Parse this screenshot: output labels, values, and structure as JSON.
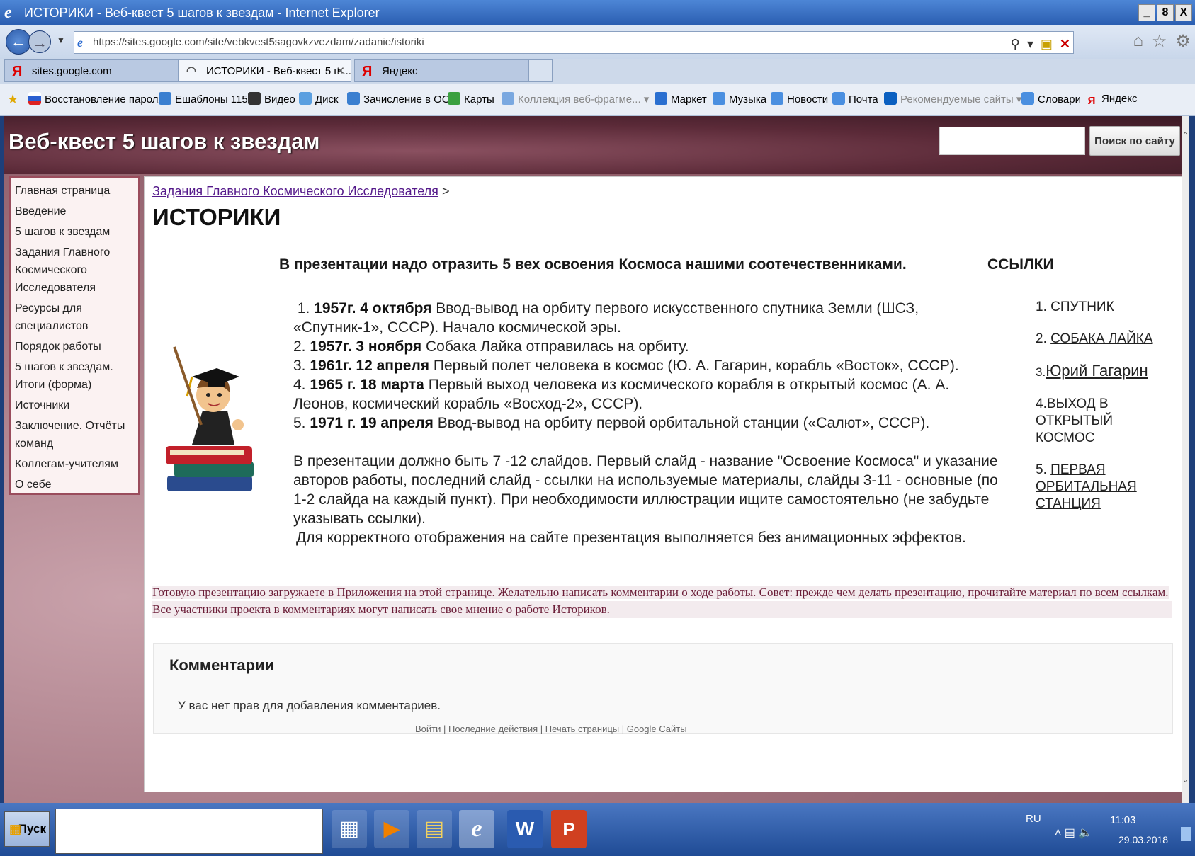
{
  "window": {
    "title": "ИСТОРИКИ - Веб-квест 5 шагов к звездам - Internet Explorer",
    "controls": [
      "_",
      "8",
      "X"
    ]
  },
  "browser": {
    "address": "https://sites.google.com/site/vebkvest5sagovkzvezdam/zadanie/istoriki",
    "tabs": [
      {
        "label": "sites.google.com",
        "icon": "yandex-icon"
      },
      {
        "label": "ИСТОРИКИ - Веб-квест 5 ш...",
        "icon": "loading-icon"
      },
      {
        "label": "Яндекс",
        "icon": "yandex-icon"
      }
    ],
    "favorites": [
      "Восстановление пароля",
      "Ешаблоны 115",
      "Видео",
      "Диск",
      "Зачисление в ОО",
      "Карты",
      "Коллекция веб-фрагме...",
      "Маркет",
      "Музыка",
      "Новости",
      "Почта",
      "Рекомендуемые сайты",
      "Словари",
      "Яндекс"
    ]
  },
  "site": {
    "title": "Веб-квест 5 шагов к звездам",
    "search_button": "Поиск по сайту",
    "nav": [
      "Главная страница",
      "Введение",
      "5 шагов к звездам",
      "Задания Главного Космического Исследователя",
      "Ресурсы для специалистов",
      "Порядок работы",
      "5 шагов к звездам. Итоги (форма)",
      "Источники",
      "Заключение. Отчёты команд",
      "Коллегам-учителям",
      "О себе"
    ]
  },
  "page": {
    "breadcrumb_link": "Задания Главного Космического Исследователя",
    "breadcrumb_sep": ">",
    "title": "ИСТОРИКИ",
    "intro": "В презентации надо отразить 5 вех освоения Космоса нашими соотечественниками.",
    "links_heading": "ССЫЛКИ",
    "milestones": [
      {
        "num": "1.",
        "date": "1957г. 4 октября",
        "text": " Ввод-вывод на орбиту первого искусственного спутника Земли (ШСЗ, «Спутник-1», СССР). Начало космической эры."
      },
      {
        "num": "2.",
        "date": "1957г. 3 ноября",
        "text": "  Собака Лайка отправилась на орбиту."
      },
      {
        "num": "3.",
        "date": "1961г.  12 апреля",
        "text": " Первый полет человека в космос (Ю. А. Гагарин, корабль «Восток», СССР)."
      },
      {
        "num": "4.",
        "date": " 1965 г. 18 марта",
        "text": " Первый выход человека из космического корабля в открытый космос (А. А. Леонов, космический корабль «Восход-2», СССР)."
      },
      {
        "num": "5.",
        "date": " 1971 г. 19 апреля",
        "text": " Ввод-вывод на орбиту первой орбитальной станции («Салют», СССР)."
      }
    ],
    "instructions": "В презентации должно быть 7 -12 слайдов. Первый слайд - название \"Освоение Космоса\" и  указание авторов работы, последний слайд - ссылки на используемые материалы, слайды 3-11 - основные (по 1-2 слайда на каждый пункт).   При необходимости иллюстрации ищите самостоятельно (не забудьте указывать ссылки).",
    "instructions2": "Для корректного отображения на сайте презентация выполняется без анимационных эффектов.",
    "links": [
      {
        "num": "1.",
        "label": " СПУТНИК"
      },
      {
        "num": "2. ",
        "label": "СОБАКА ЛАЙКА"
      },
      {
        "num": "3.",
        "label": "Юрий Гагарин"
      },
      {
        "num": "4.",
        "label": "ВЫХОД В ОТКРЫТЫЙ КОСМОС"
      },
      {
        "num": "5. ",
        "label": "ПЕРВАЯ ОРБИТАЛЬНАЯ СТАНЦИЯ"
      }
    ],
    "note1": "Готовую презентацию загружаете в Приложения на этой странице. Желательно написать комментарии о ходе работы. Совет: прежде чем делать презентацию, прочитайте материал по всем ссылкам.",
    "note2": "Все участники проекта в комментариях могут написать свое мнение о работе Историков.",
    "comments_title": "Комментарии",
    "comments_message": "У вас нет прав для добавления комментариев.",
    "footer": "Войти | Последние действия | Печать страницы | Google Сайты"
  },
  "taskbar": {
    "start": "Пуск",
    "apps": [
      "calculator-icon",
      "media-player-icon",
      "explorer-icon",
      "internet-explorer-icon",
      "word-icon",
      "powerpoint-icon"
    ],
    "lang": "RU",
    "time": "11:03",
    "date": "29.03.2018"
  },
  "colors": {
    "accent": "#6b1e38",
    "header": "#5b2a38",
    "titlebar": "#2a5db0",
    "link": "#551a8b"
  }
}
